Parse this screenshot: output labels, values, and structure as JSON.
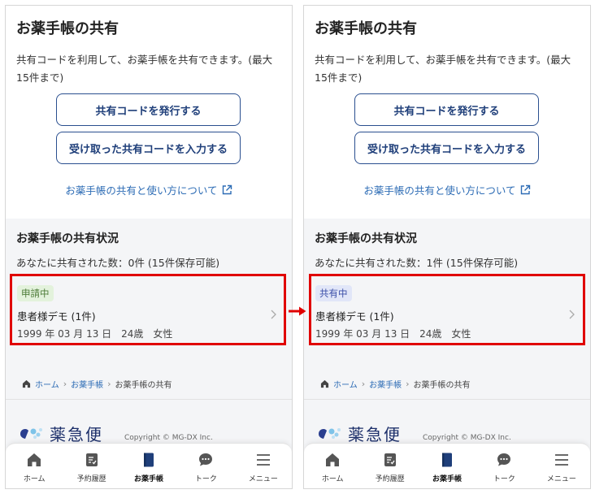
{
  "page_title": "お薬手帳の共有",
  "description": "共有コードを利用して、お薬手帳を共有できます。(最大15件まで)",
  "buttons": {
    "issue_code": "共有コードを発行する",
    "enter_code": "受け取った共有コードを入力する"
  },
  "help_link": "お薬手帳の共有と使い方について",
  "status_section": {
    "title": "お薬手帳の共有状況"
  },
  "screens": {
    "left": {
      "shared_count": "あなたに共有された数：0件 (15件保存可能)",
      "item": {
        "badge": "申請中",
        "name": "患者様デモ (1件)",
        "info": "1999 年 03 月 13 日　24歳　女性"
      }
    },
    "right": {
      "shared_count": "あなたに共有された数：1件 (15件保存可能)",
      "item": {
        "badge": "共有中",
        "name": "患者様デモ (1件)",
        "info": "1999 年 03 月 13 日　24歳　女性"
      }
    }
  },
  "breadcrumb": {
    "home": "ホーム",
    "notebook": "お薬手帳",
    "current": "お薬手帳の共有"
  },
  "footer": {
    "logo_text": "薬急便",
    "copyright": "Copyright © MG-DX Inc."
  },
  "tabbar": [
    {
      "label": "ホーム",
      "icon": "home-icon"
    },
    {
      "label": "予約履歴",
      "icon": "history-icon"
    },
    {
      "label": "お薬手帳",
      "icon": "notebook-icon",
      "active": true
    },
    {
      "label": "トーク",
      "icon": "chat-icon"
    },
    {
      "label": "メニュー",
      "icon": "menu-icon"
    }
  ],
  "colors": {
    "primary": "#1f3f7a",
    "link": "#2d6cb5",
    "highlight_frame": "#e00000",
    "pending_badge_bg": "#e3f2dc",
    "shared_badge_bg": "#e1e6f8"
  }
}
